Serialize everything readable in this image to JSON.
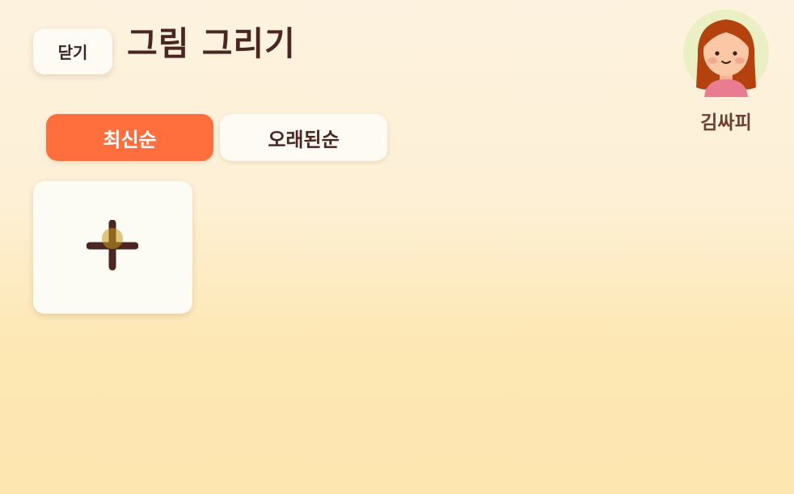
{
  "header": {
    "close_label": "닫기",
    "title": "그림 그리기"
  },
  "sort_tabs": [
    {
      "label": "최신순",
      "active": true
    },
    {
      "label": "오래된순",
      "active": false
    }
  ],
  "drawings": {
    "add_icon": "plus-icon"
  },
  "profile": {
    "name": "김싸피",
    "avatar_icon": "girl-avatar"
  },
  "colors": {
    "accent": "#ff6e3c",
    "title_text": "#4a2722",
    "card_bg": "#fdfbf3",
    "avatar_bg": "#eaf0c4"
  }
}
